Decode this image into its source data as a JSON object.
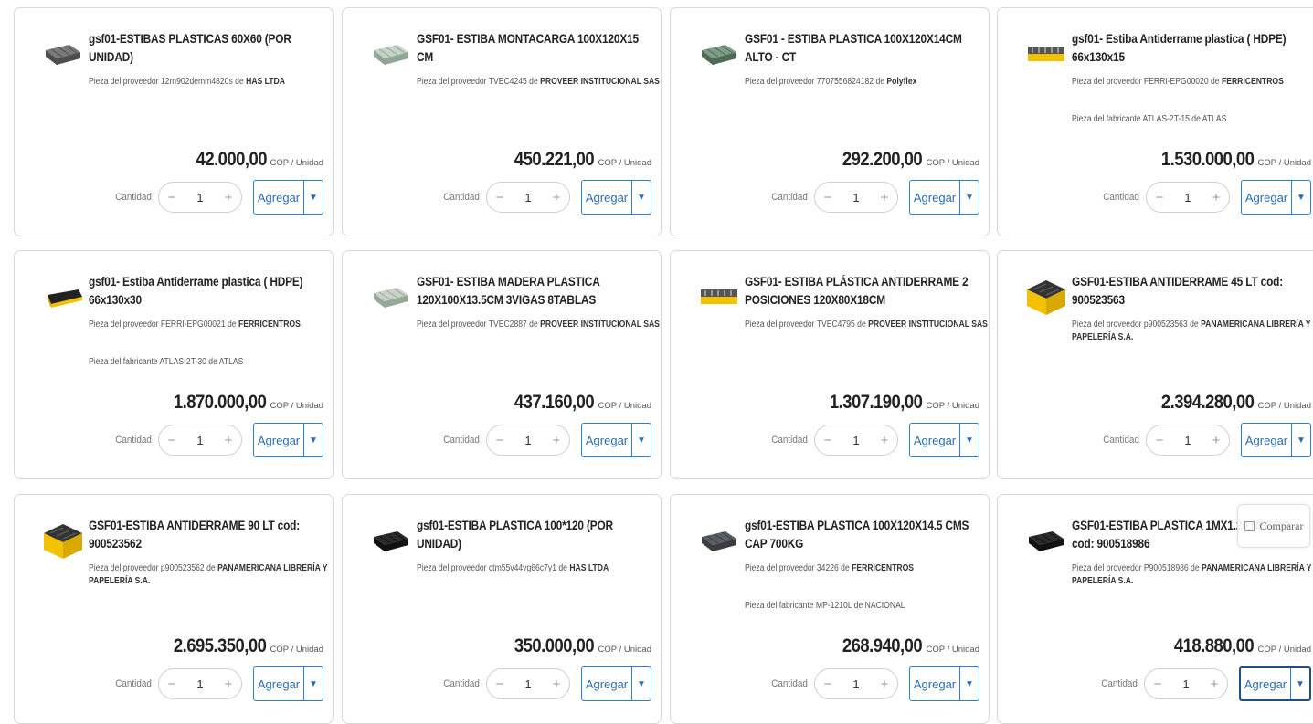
{
  "labels": {
    "qty_label": "Cantidad",
    "add_label": "Agregar",
    "unit": "COP / Unidad",
    "compare": "Comparar"
  },
  "colors": {
    "accent": "#2a7fd1",
    "border": "#d8d8d8"
  },
  "products": [
    {
      "title": "gsf01-ESTIBAS PLASTICAS 60X60 (POR UNIDAD)",
      "supplier_prefix": "Pieza del proveedor 12rn902demm4820s de ",
      "supplier": "HAS LTDA",
      "manufacturer": "",
      "price": "42.000,00",
      "qty": "1",
      "icon": "pallet-grey-icon"
    },
    {
      "title": "GSF01- ESTIBA MONTACARGA 100X120X15 CM",
      "supplier_prefix": "Pieza del proveedor TVEC4245 de ",
      "supplier": "PROVEER INSTITUCIONAL SAS",
      "manufacturer": "",
      "price": "450.221,00",
      "qty": "1",
      "icon": "pallet-light-icon"
    },
    {
      "title": "GSF01 - ESTIBA PLASTICA 100X120X14CM ALTO - CT",
      "supplier_prefix": "Pieza del proveedor 7707556824182 de ",
      "supplier": "Polyflex",
      "manufacturer": "",
      "price": "292.200,00",
      "qty": "1",
      "icon": "pallet-green-icon"
    },
    {
      "title": "gsf01- Estiba Antiderrame plastica ( HDPE) 66x130x15",
      "supplier_prefix": "Pieza del proveedor FERRI-EPG00020 de ",
      "supplier": "FERRICENTROS",
      "manufacturer": "Pieza del fabricante ATLAS-2T-15 de ATLAS",
      "price": "1.530.000,00",
      "qty": "1",
      "icon": "spill-pallet-yellow-icon"
    },
    {
      "title": "gsf01- Estiba Antiderrame plastica ( HDPE) 66x130x30",
      "supplier_prefix": "Pieza del proveedor FERRI-EPG00021 de ",
      "supplier": "FERRICENTROS",
      "manufacturer": "Pieza del fabricante ATLAS-2T-30 de ATLAS",
      "price": "1.870.000,00",
      "qty": "1",
      "icon": "spill-tray-yellow-icon"
    },
    {
      "title": "GSF01- ESTIBA MADERA PLASTICA 120X100X13.5CM 3VIGAS 8TABLAS",
      "supplier_prefix": "Pieza del proveedor TVEC2887 de ",
      "supplier": "PROVEER INSTITUCIONAL SAS",
      "manufacturer": "",
      "price": "437.160,00",
      "qty": "1",
      "icon": "pallet-wood-icon"
    },
    {
      "title": "GSF01- ESTIBA PLÁSTICA ANTIDERRAME 2 POSICIONES 120X80X18CM",
      "supplier_prefix": "Pieza del proveedor TVEC4795 de ",
      "supplier": "PROVEER INSTITUCIONAL SAS",
      "manufacturer": "",
      "price": "1.307.190,00",
      "qty": "1",
      "icon": "spill-pallet-yellow-icon"
    },
    {
      "title": "GSF01-ESTIBA ANTIDERRAME 45 LT cod: 900523563",
      "supplier_prefix": "Pieza del proveedor p900523563 de ",
      "supplier": "PANAMERICANA LIBRERÍA Y PAPELERÍA S.A.",
      "manufacturer": "",
      "price": "2.394.280,00",
      "qty": "1",
      "icon": "spill-box-yellow-icon"
    },
    {
      "title": "GSF01-ESTIBA ANTIDERRAME 90 LT cod: 900523562",
      "supplier_prefix": "Pieza del proveedor p900523562 de ",
      "supplier": "PANAMERICANA LIBRERÍA Y PAPELERÍA S.A.",
      "manufacturer": "",
      "price": "2.695.350,00",
      "qty": "1",
      "icon": "spill-box-yellow-icon"
    },
    {
      "title": "gsf01-ESTIBA PLASTICA 100*120 (POR UNIDAD)",
      "supplier_prefix": "Pieza del proveedor ctm55v44vg66c7y1 de ",
      "supplier": "HAS LTDA",
      "manufacturer": "",
      "price": "350.000,00",
      "qty": "1",
      "icon": "pallet-black-icon"
    },
    {
      "title": "gsf01-ESTIBA PLASTICA 100X120X14.5 CMS CAP 700KG",
      "supplier_prefix": "Pieza del proveedor 34226 de ",
      "supplier": "FERRICENTROS",
      "manufacturer": "Pieza del fabricante MP-1210L de NACIONAL",
      "price": "268.940,00",
      "qty": "1",
      "icon": "pallet-dark-grey-icon"
    },
    {
      "title": "GSF01-ESTIBA PLASTICA 1MX1.20 NEGRO cod: 900518986",
      "supplier_prefix": "Pieza del proveedor P900518986 de ",
      "supplier": "PANAMERICANA LIBRERÍA Y PAPELERÍA S.A.",
      "manufacturer": "",
      "price": "418.880,00",
      "qty": "1",
      "icon": "pallet-black-icon"
    }
  ]
}
